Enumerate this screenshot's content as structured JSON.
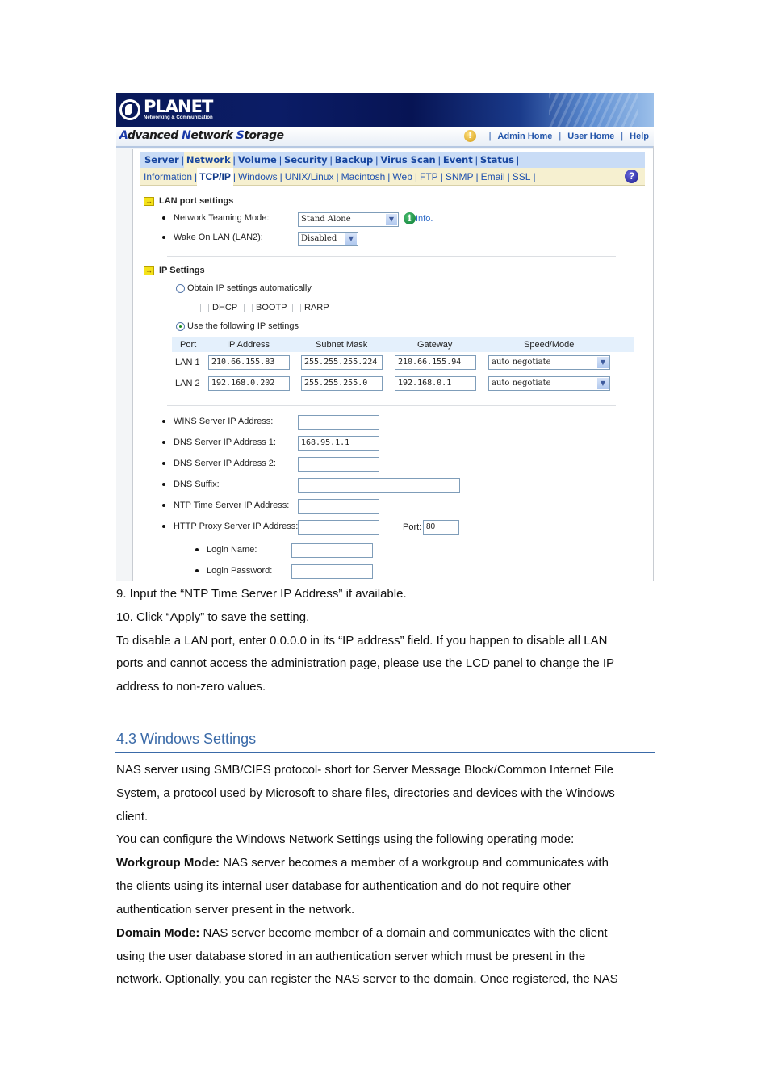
{
  "screenshot": {
    "brand": {
      "name": "PLANET",
      "tagline": "Networking & Communication"
    },
    "app_title": {
      "parts": [
        {
          "cap": "A",
          "rest": "dvanced "
        },
        {
          "cap": "N",
          "rest": "etwork "
        },
        {
          "cap": "S",
          "rest": "torage"
        }
      ]
    },
    "top_links": [
      {
        "label": "Admin Home"
      },
      {
        "label": "User Home"
      },
      {
        "label": "Help"
      }
    ],
    "top_icons": {
      "alert": "!",
      "help": "?"
    },
    "main_nav": [
      {
        "label": "Server",
        "active": false
      },
      {
        "label": "Network",
        "active": true
      },
      {
        "label": "Volume",
        "active": false
      },
      {
        "label": "Security",
        "active": false
      },
      {
        "label": "Backup",
        "active": false
      },
      {
        "label": "Virus Scan",
        "active": false
      },
      {
        "label": "Event",
        "active": false
      },
      {
        "label": "Status",
        "active": false
      }
    ],
    "sub_nav": [
      {
        "label": "Information",
        "active": false
      },
      {
        "label": "TCP/IP",
        "active": true
      },
      {
        "label": "Windows",
        "active": false
      },
      {
        "label": "UNIX/Linux",
        "active": false
      },
      {
        "label": "Macintosh",
        "active": false
      },
      {
        "label": "Web",
        "active": false
      },
      {
        "label": "FTP",
        "active": false
      },
      {
        "label": "SNMP",
        "active": false
      },
      {
        "label": "Email",
        "active": false
      },
      {
        "label": "SSL",
        "active": false
      }
    ],
    "lan_port": {
      "heading": "LAN port settings",
      "teaming_label": "Network Teaming Mode:",
      "teaming_value": "Stand Alone",
      "info_label": "Info.",
      "info_glyph": "i",
      "wol_label": "Wake On LAN (LAN2):",
      "wol_value": "Disabled"
    },
    "ip_settings": {
      "heading": "IP Settings",
      "auto_label": "Obtain IP settings automatically",
      "auto_selected": false,
      "protocols": [
        {
          "label": "DHCP",
          "checked": false
        },
        {
          "label": "BOOTP",
          "checked": false
        },
        {
          "label": "RARP",
          "checked": false
        }
      ],
      "manual_label": "Use the following IP settings",
      "manual_selected": true,
      "columns": [
        "Port",
        "IP Address",
        "Subnet Mask",
        "Gateway",
        "Speed/Mode"
      ],
      "rows": [
        {
          "port": "LAN 1",
          "ip": "210.66.155.83",
          "mask": "255.255.255.224",
          "gateway": "210.66.155.94",
          "mode": "auto negotiate"
        },
        {
          "port": "LAN 2",
          "ip": "192.168.0.202",
          "mask": "255.255.255.0",
          "gateway": "192.168.0.1",
          "mode": "auto negotiate"
        }
      ]
    },
    "servers": {
      "wins_label": "WINS Server IP Address:",
      "wins_value": "",
      "dns1_label": "DNS Server IP Address 1:",
      "dns1_value": "168.95.1.1",
      "dns2_label": "DNS Server IP Address 2:",
      "dns2_value": "",
      "suffix_label": "DNS Suffix:",
      "suffix_value": "",
      "ntp_label": "NTP Time Server IP Address:",
      "ntp_value": "",
      "proxy_label": "HTTP Proxy Server IP Address:",
      "proxy_value": "",
      "port_label": "Port:",
      "port_value": "80",
      "login_name_label": "Login Name:",
      "login_name_value": "",
      "login_password_label": "Login Password:",
      "login_password_value": ""
    }
  },
  "document": {
    "step9": "9. Input the “NTP Time Server IP Address” if available.",
    "step10": "10. Click “Apply” to save the setting.",
    "note_line1": "To disable a LAN port, enter 0.0.0.0 in its “IP address” field. If you happen to disable all LAN",
    "note_line2": "ports and cannot access the administration page, please use the LCD panel to change the IP",
    "note_line3": "address to non-zero values.",
    "section_heading": "4.3 Windows Settings",
    "intro_line1": "NAS server using SMB/CIFS protocol- short for Server Message Block/Common Internet File",
    "intro_line2": "System, a protocol used by Microsoft to share files, directories and devices with the Windows",
    "intro_line3": "client.",
    "configure_line": "You can configure the Windows Network Settings using the following operating mode:",
    "workgroup_term": "Workgroup Mode:",
    "workgroup_line1": " NAS server becomes a member of a workgroup and communicates with",
    "workgroup_line2": "the clients using its internal user database for authentication and do not require other",
    "workgroup_line3": "authentication server present in the network.",
    "domain_term": "Domain Mode:",
    "domain_line1": " NAS server become member of a domain and communicates with the client",
    "domain_line2": "using the user database stored in an authentication server which must be present in the",
    "domain_line3": "network. Optionally, you can register the NAS server to the domain. Once registered, the NAS"
  }
}
